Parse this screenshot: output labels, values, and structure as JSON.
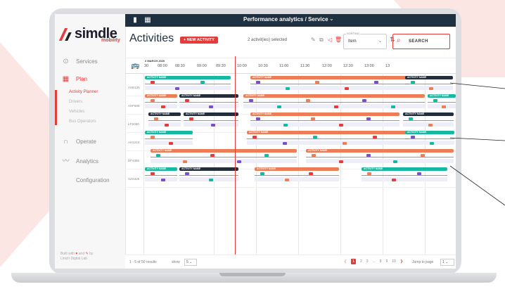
{
  "app": {
    "logo_text": "simdle",
    "logo_sub": "mobility",
    "header_title": "Performance analytics / Service",
    "page_title": "Activities",
    "new_activity_label": "+ NEW ACTIVITY",
    "selected_text": "2 activit(ies) selected",
    "sorting_label": "SORTING",
    "sorting_value": "Item",
    "search_label": "SEARCH"
  },
  "sidebar": {
    "services": "Services",
    "plan": "Plan",
    "sub_items": [
      "Activity Planner",
      "Drivers",
      "Vehicles",
      "Bus Operators"
    ],
    "operate": "Operate",
    "analytics": "Analytics",
    "configuration": "Configuration",
    "built_with": "Built with",
    "built_and": "and",
    "built_by": "by",
    "built_org": "Linich Digital Lab"
  },
  "timeline": {
    "date": "2 MARCH 2020",
    "ticks": [
      "30",
      "08:00",
      "08:30",
      "09:00",
      "09:30",
      "10:00",
      "10:30",
      "11:00",
      "11:30",
      "12:00",
      "12:30",
      "13:00",
      "13"
    ],
    "rows": [
      "ASD125",
      "AHF608",
      "LFS050",
      "AH1210",
      "DF4356",
      "SZS426"
    ],
    "activity_label": "ACTIVITY NAME"
  },
  "colors": {
    "accent": "#e63b3b",
    "green": "#15b8a0",
    "orange": "#ec7d57",
    "dark": "#232e3c",
    "header_bg": "#1f3141"
  },
  "footer": {
    "results": "1 - 5 of 50 results",
    "show_label": "show",
    "show_value": "5",
    "pages": [
      "1",
      "2",
      "3",
      "...",
      "8",
      "9",
      "10"
    ],
    "jump_label": "Jump to page",
    "jump_value": "1"
  }
}
